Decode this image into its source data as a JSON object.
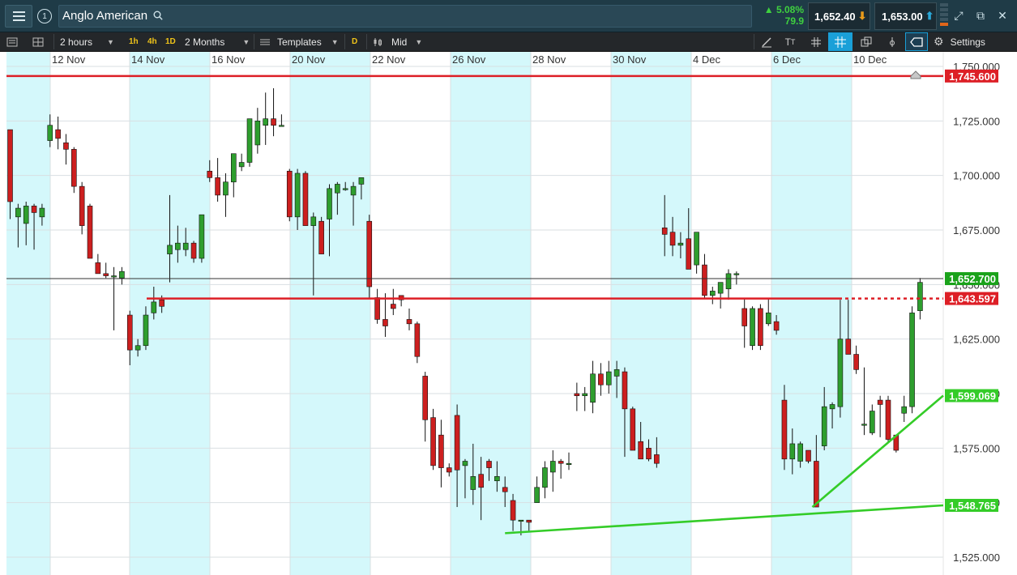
{
  "header": {
    "instrument": "Anglo American",
    "change_pct": "▲ 5.08%",
    "change_pts": "79.9",
    "sell_price": "1,652.40",
    "buy_price": "1,653.00"
  },
  "toolbar": {
    "interval": "2 hours",
    "quick_intervals": [
      "1h",
      "4h",
      "1D"
    ],
    "range": "2 Months",
    "templates": "Templates",
    "d_badge": "D",
    "price_type": "Mid",
    "settings": "Settings"
  },
  "colors": {
    "up": "#2e9e2e",
    "down": "#cc1f1f",
    "band": "#d4f8fb",
    "resistance_line": "#dd1f26",
    "trend_line": "#34cc28",
    "last_price_bg": "#1aa21a"
  },
  "chart_data": {
    "type": "candlestick",
    "title": "",
    "x_tick_labels": [
      "12 Nov",
      "14 Nov",
      "16 Nov",
      "20 Nov",
      "22 Nov",
      "26 Nov",
      "28 Nov",
      "30 Nov",
      "4 Dec",
      "6 Dec",
      "10 Dec"
    ],
    "y_tick_labels": [
      "1,750.000",
      "1,725.000",
      "1,700.000",
      "1,675.000",
      "1,650.000",
      "1,625.000",
      "1,600.000",
      "1,575.000",
      "1,550.000",
      "1,525.000"
    ],
    "y_ticks": [
      1750,
      1725,
      1700,
      1675,
      1650,
      1625,
      1600,
      1575,
      1550,
      1525
    ],
    "ylim": [
      1521.4,
      1760.0
    ],
    "grid": true,
    "last_price": 1652.7,
    "last_price_label": "1,652.700",
    "horizontal_lines": [
      {
        "value": 1745.6,
        "label": "1,745.600"
      },
      {
        "value": 1643.597,
        "label": "1,643.597"
      }
    ],
    "trend_lines": [
      {
        "from": [
          62,
          1536.0
        ],
        "to": [
          116.5,
          1551.0
        ],
        "end_label": "1,548.765",
        "end_value": 1548.765
      },
      {
        "from": [
          100.5,
          1548.0
        ],
        "to": [
          116.5,
          1599.1
        ],
        "end_label": "1,599.069",
        "end_value": 1599.069
      }
    ],
    "candles": [
      {
        "o": 1721,
        "h": 1721,
        "l": 1680,
        "c": 1688
      },
      {
        "o": 1681,
        "h": 1687,
        "l": 1667,
        "c": 1685
      },
      {
        "o": 1678,
        "h": 1688,
        "l": 1668,
        "c": 1686
      },
      {
        "o": 1686,
        "h": 1687,
        "l": 1666,
        "c": 1683
      },
      {
        "o": 1681,
        "h": 1687,
        "l": 1677,
        "c": 1685
      },
      {
        "o": 1716,
        "h": 1728,
        "l": 1713,
        "c": 1723
      },
      {
        "o": 1721,
        "h": 1727,
        "l": 1712,
        "c": 1717
      },
      {
        "o": 1715,
        "h": 1719,
        "l": 1705,
        "c": 1712
      },
      {
        "o": 1712,
        "h": 1713,
        "l": 1692,
        "c": 1695
      },
      {
        "o": 1695,
        "h": 1697,
        "l": 1673,
        "c": 1677
      },
      {
        "o": 1686,
        "h": 1687,
        "l": 1662,
        "c": 1662
      },
      {
        "o": 1660,
        "h": 1664,
        "l": 1655,
        "c": 1655
      },
      {
        "o": 1655,
        "h": 1660,
        "l": 1653,
        "c": 1654
      },
      {
        "o": 1654,
        "h": 1658,
        "l": 1629,
        "c": 1654
      },
      {
        "o": 1653,
        "h": 1658,
        "l": 1650,
        "c": 1656
      },
      {
        "o": 1636,
        "h": 1638,
        "l": 1613,
        "c": 1620
      },
      {
        "o": 1620,
        "h": 1625,
        "l": 1617,
        "c": 1622
      },
      {
        "o": 1622,
        "h": 1640,
        "l": 1620,
        "c": 1636
      },
      {
        "o": 1637,
        "h": 1649,
        "l": 1634,
        "c": 1642
      },
      {
        "o": 1643,
        "h": 1645,
        "l": 1637,
        "c": 1640
      },
      {
        "o": 1664,
        "h": 1691,
        "l": 1651,
        "c": 1668
      },
      {
        "o": 1666,
        "h": 1677,
        "l": 1660,
        "c": 1669
      },
      {
        "o": 1666,
        "h": 1676,
        "l": 1663,
        "c": 1669
      },
      {
        "o": 1669,
        "h": 1670,
        "l": 1660,
        "c": 1662
      },
      {
        "o": 1662,
        "h": 1682,
        "l": 1660,
        "c": 1682
      },
      {
        "o": 1702,
        "h": 1707,
        "l": 1697,
        "c": 1699
      },
      {
        "o": 1699,
        "h": 1708,
        "l": 1688,
        "c": 1691
      },
      {
        "o": 1691,
        "h": 1701,
        "l": 1681,
        "c": 1697
      },
      {
        "o": 1697,
        "h": 1708,
        "l": 1690,
        "c": 1710
      },
      {
        "o": 1704,
        "h": 1710,
        "l": 1702,
        "c": 1706
      },
      {
        "o": 1706,
        "h": 1718,
        "l": 1704,
        "c": 1726
      },
      {
        "o": 1714,
        "h": 1731,
        "l": 1710,
        "c": 1725
      },
      {
        "o": 1723,
        "h": 1738,
        "l": 1714,
        "c": 1726
      },
      {
        "o": 1726,
        "h": 1740,
        "l": 1718,
        "c": 1723
      },
      {
        "o": 1723,
        "h": 1728,
        "l": 1723,
        "c": 1723
      },
      {
        "o": 1702,
        "h": 1703,
        "l": 1679,
        "c": 1681
      },
      {
        "o": 1681,
        "h": 1703,
        "l": 1675,
        "c": 1701
      },
      {
        "o": 1701,
        "h": 1702,
        "l": 1677,
        "c": 1677
      },
      {
        "o": 1677,
        "h": 1683,
        "l": 1645,
        "c": 1681
      },
      {
        "o": 1679,
        "h": 1681,
        "l": 1667,
        "c": 1664
      },
      {
        "o": 1680,
        "h": 1696,
        "l": 1663,
        "c": 1694
      },
      {
        "o": 1692,
        "h": 1697,
        "l": 1682,
        "c": 1696
      },
      {
        "o": 1694,
        "h": 1697,
        "l": 1693,
        "c": 1694
      },
      {
        "o": 1691,
        "h": 1697,
        "l": 1677,
        "c": 1695
      },
      {
        "o": 1696,
        "h": 1699,
        "l": 1689,
        "c": 1699
      },
      {
        "o": 1679,
        "h": 1682,
        "l": 1644,
        "c": 1649
      },
      {
        "o": 1644,
        "h": 1648,
        "l": 1632,
        "c": 1634
      },
      {
        "o": 1634,
        "h": 1646,
        "l": 1626,
        "c": 1631
      },
      {
        "o": 1641,
        "h": 1648,
        "l": 1636,
        "c": 1639
      },
      {
        "o": 1645,
        "h": 1645,
        "l": 1640,
        "c": 1643
      },
      {
        "o": 1634,
        "h": 1639,
        "l": 1629,
        "c": 1632
      },
      {
        "o": 1632,
        "h": 1633,
        "l": 1614,
        "c": 1617
      },
      {
        "o": 1608,
        "h": 1610,
        "l": 1578,
        "c": 1588
      },
      {
        "o": 1589,
        "h": 1593,
        "l": 1565,
        "c": 1567
      },
      {
        "o": 1581,
        "h": 1588,
        "l": 1557,
        "c": 1566
      },
      {
        "o": 1566,
        "h": 1568,
        "l": 1562,
        "c": 1564
      },
      {
        "o": 1590,
        "h": 1595,
        "l": 1548,
        "c": 1565
      },
      {
        "o": 1567,
        "h": 1570,
        "l": 1552,
        "c": 1569
      },
      {
        "o": 1556,
        "h": 1577,
        "l": 1549,
        "c": 1562
      },
      {
        "o": 1563,
        "h": 1571,
        "l": 1542,
        "c": 1557
      },
      {
        "o": 1569,
        "h": 1570,
        "l": 1560,
        "c": 1566
      },
      {
        "o": 1560,
        "h": 1569,
        "l": 1555,
        "c": 1562
      },
      {
        "o": 1557,
        "h": 1562,
        "l": 1548,
        "c": 1555
      },
      {
        "o": 1551,
        "h": 1554,
        "l": 1537,
        "c": 1542
      },
      {
        "o": 1542,
        "h": 1539,
        "l": 1535,
        "c": 1542
      },
      {
        "o": 1542,
        "h": 1542,
        "l": 1537,
        "c": 1541
      },
      {
        "o": 1550,
        "h": 1562,
        "l": 1550,
        "c": 1557
      },
      {
        "o": 1557,
        "h": 1569,
        "l": 1552,
        "c": 1566
      },
      {
        "o": 1564,
        "h": 1574,
        "l": 1555,
        "c": 1569
      },
      {
        "o": 1569,
        "h": 1570,
        "l": 1561,
        "c": 1568
      },
      {
        "o": 1568,
        "h": 1573,
        "l": 1565,
        "c": 1568
      },
      {
        "o": 1600,
        "h": 1605,
        "l": 1592,
        "c": 1599
      },
      {
        "o": 1599,
        "h": 1603,
        "l": 1592,
        "c": 1600
      },
      {
        "o": 1596,
        "h": 1615,
        "l": 1591,
        "c": 1609
      },
      {
        "o": 1609,
        "h": 1614,
        "l": 1599,
        "c": 1604
      },
      {
        "o": 1604,
        "h": 1615,
        "l": 1600,
        "c": 1610
      },
      {
        "o": 1608,
        "h": 1615,
        "l": 1598,
        "c": 1611
      },
      {
        "o": 1610,
        "h": 1612,
        "l": 1571,
        "c": 1593
      },
      {
        "o": 1593,
        "h": 1594,
        "l": 1578,
        "c": 1574
      },
      {
        "o": 1578,
        "h": 1587,
        "l": 1572,
        "c": 1570
      },
      {
        "o": 1575,
        "h": 1579,
        "l": 1569,
        "c": 1570
      },
      {
        "o": 1572,
        "h": 1580,
        "l": 1566,
        "c": 1568
      },
      {
        "o": 1676,
        "h": 1691,
        "l": 1663,
        "c": 1673
      },
      {
        "o": 1674,
        "h": 1681,
        "l": 1663,
        "c": 1668
      },
      {
        "o": 1668,
        "h": 1674,
        "l": 1662,
        "c": 1669
      },
      {
        "o": 1671,
        "h": 1685,
        "l": 1657,
        "c": 1657
      },
      {
        "o": 1659,
        "h": 1673,
        "l": 1655,
        "c": 1674
      },
      {
        "o": 1659,
        "h": 1664,
        "l": 1644,
        "c": 1645
      },
      {
        "o": 1645,
        "h": 1649,
        "l": 1641,
        "c": 1647
      },
      {
        "o": 1646,
        "h": 1650,
        "l": 1639,
        "c": 1651
      },
      {
        "o": 1648,
        "h": 1657,
        "l": 1643,
        "c": 1655
      },
      {
        "o": 1655,
        "h": 1656,
        "l": 1650,
        "c": 1655
      },
      {
        "o": 1639,
        "h": 1644,
        "l": 1621,
        "c": 1631
      },
      {
        "o": 1622,
        "h": 1640,
        "l": 1620,
        "c": 1639
      },
      {
        "o": 1639,
        "h": 1641,
        "l": 1620,
        "c": 1622
      },
      {
        "o": 1632,
        "h": 1644,
        "l": 1631,
        "c": 1637
      },
      {
        "o": 1633,
        "h": 1636,
        "l": 1627,
        "c": 1629
      },
      {
        "o": 1597,
        "h": 1604,
        "l": 1565,
        "c": 1570
      },
      {
        "o": 1570,
        "h": 1584,
        "l": 1563,
        "c": 1577
      },
      {
        "o": 1569,
        "h": 1578,
        "l": 1566,
        "c": 1577
      },
      {
        "o": 1574,
        "h": 1572,
        "l": 1568,
        "c": 1569
      },
      {
        "o": 1569,
        "h": 1581,
        "l": 1550,
        "c": 1548
      },
      {
        "o": 1576,
        "h": 1603,
        "l": 1574,
        "c": 1594
      },
      {
        "o": 1593,
        "h": 1596,
        "l": 1584,
        "c": 1595
      },
      {
        "o": 1594,
        "h": 1643,
        "l": 1589,
        "c": 1625
      },
      {
        "o": 1625,
        "h": 1643,
        "l": 1618,
        "c": 1618
      },
      {
        "o": 1618,
        "h": 1622,
        "l": 1609,
        "c": 1611
      },
      {
        "o": 1586,
        "h": 1612,
        "l": 1581,
        "c": 1586
      },
      {
        "o": 1582,
        "h": 1595,
        "l": 1581,
        "c": 1592
      },
      {
        "o": 1597,
        "h": 1599,
        "l": 1580,
        "c": 1595
      },
      {
        "o": 1597,
        "h": 1599,
        "l": 1578,
        "c": 1579
      },
      {
        "o": 1581,
        "h": 1578,
        "l": 1573,
        "c": 1574
      },
      {
        "o": 1591,
        "h": 1599,
        "l": 1587,
        "c": 1594
      },
      {
        "o": 1594,
        "h": 1640,
        "l": 1591,
        "c": 1637
      },
      {
        "o": 1638,
        "h": 1653,
        "l": 1634,
        "c": 1651
      }
    ]
  }
}
